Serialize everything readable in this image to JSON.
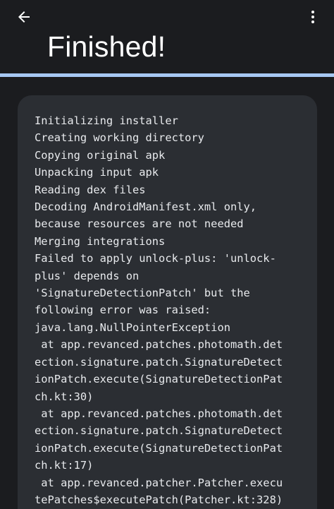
{
  "header": {
    "title": "Finished!",
    "back_icon": "arrow-left-icon",
    "menu_icon": "more-vert-icon"
  },
  "progress": {
    "value": 1.0
  },
  "log": {
    "lines": [
      "Initializing installer",
      "Creating working directory",
      "Copying original apk",
      "Unpacking input apk",
      "Reading dex files",
      "Decoding AndroidManifest.xml only,",
      "because resources are not needed",
      "Merging integrations",
      "Failed to apply unlock-plus: 'unlock-",
      "plus' depends on",
      "'SignatureDetectionPatch' but the",
      "following error was raised:",
      "java.lang.NullPointerException",
      " at app.revanced.patches.photomath.det",
      "ection.signature.patch.SignatureDetect",
      "ionPatch.execute(SignatureDetectionPat",
      "ch.kt:30)",
      " at app.revanced.patches.photomath.det",
      "ection.signature.patch.SignatureDetect",
      "ionPatch.execute(SignatureDetectionPat",
      "ch.kt:17)",
      " at app.revanced.patcher.Patcher.execu",
      "tePatches$executePatch(Patcher.kt:328)"
    ]
  },
  "colors": {
    "background": "#1b1c1f",
    "card": "#2b2e33",
    "progress_track": "#7c8da3",
    "progress_fill": "#a7c8f2"
  }
}
